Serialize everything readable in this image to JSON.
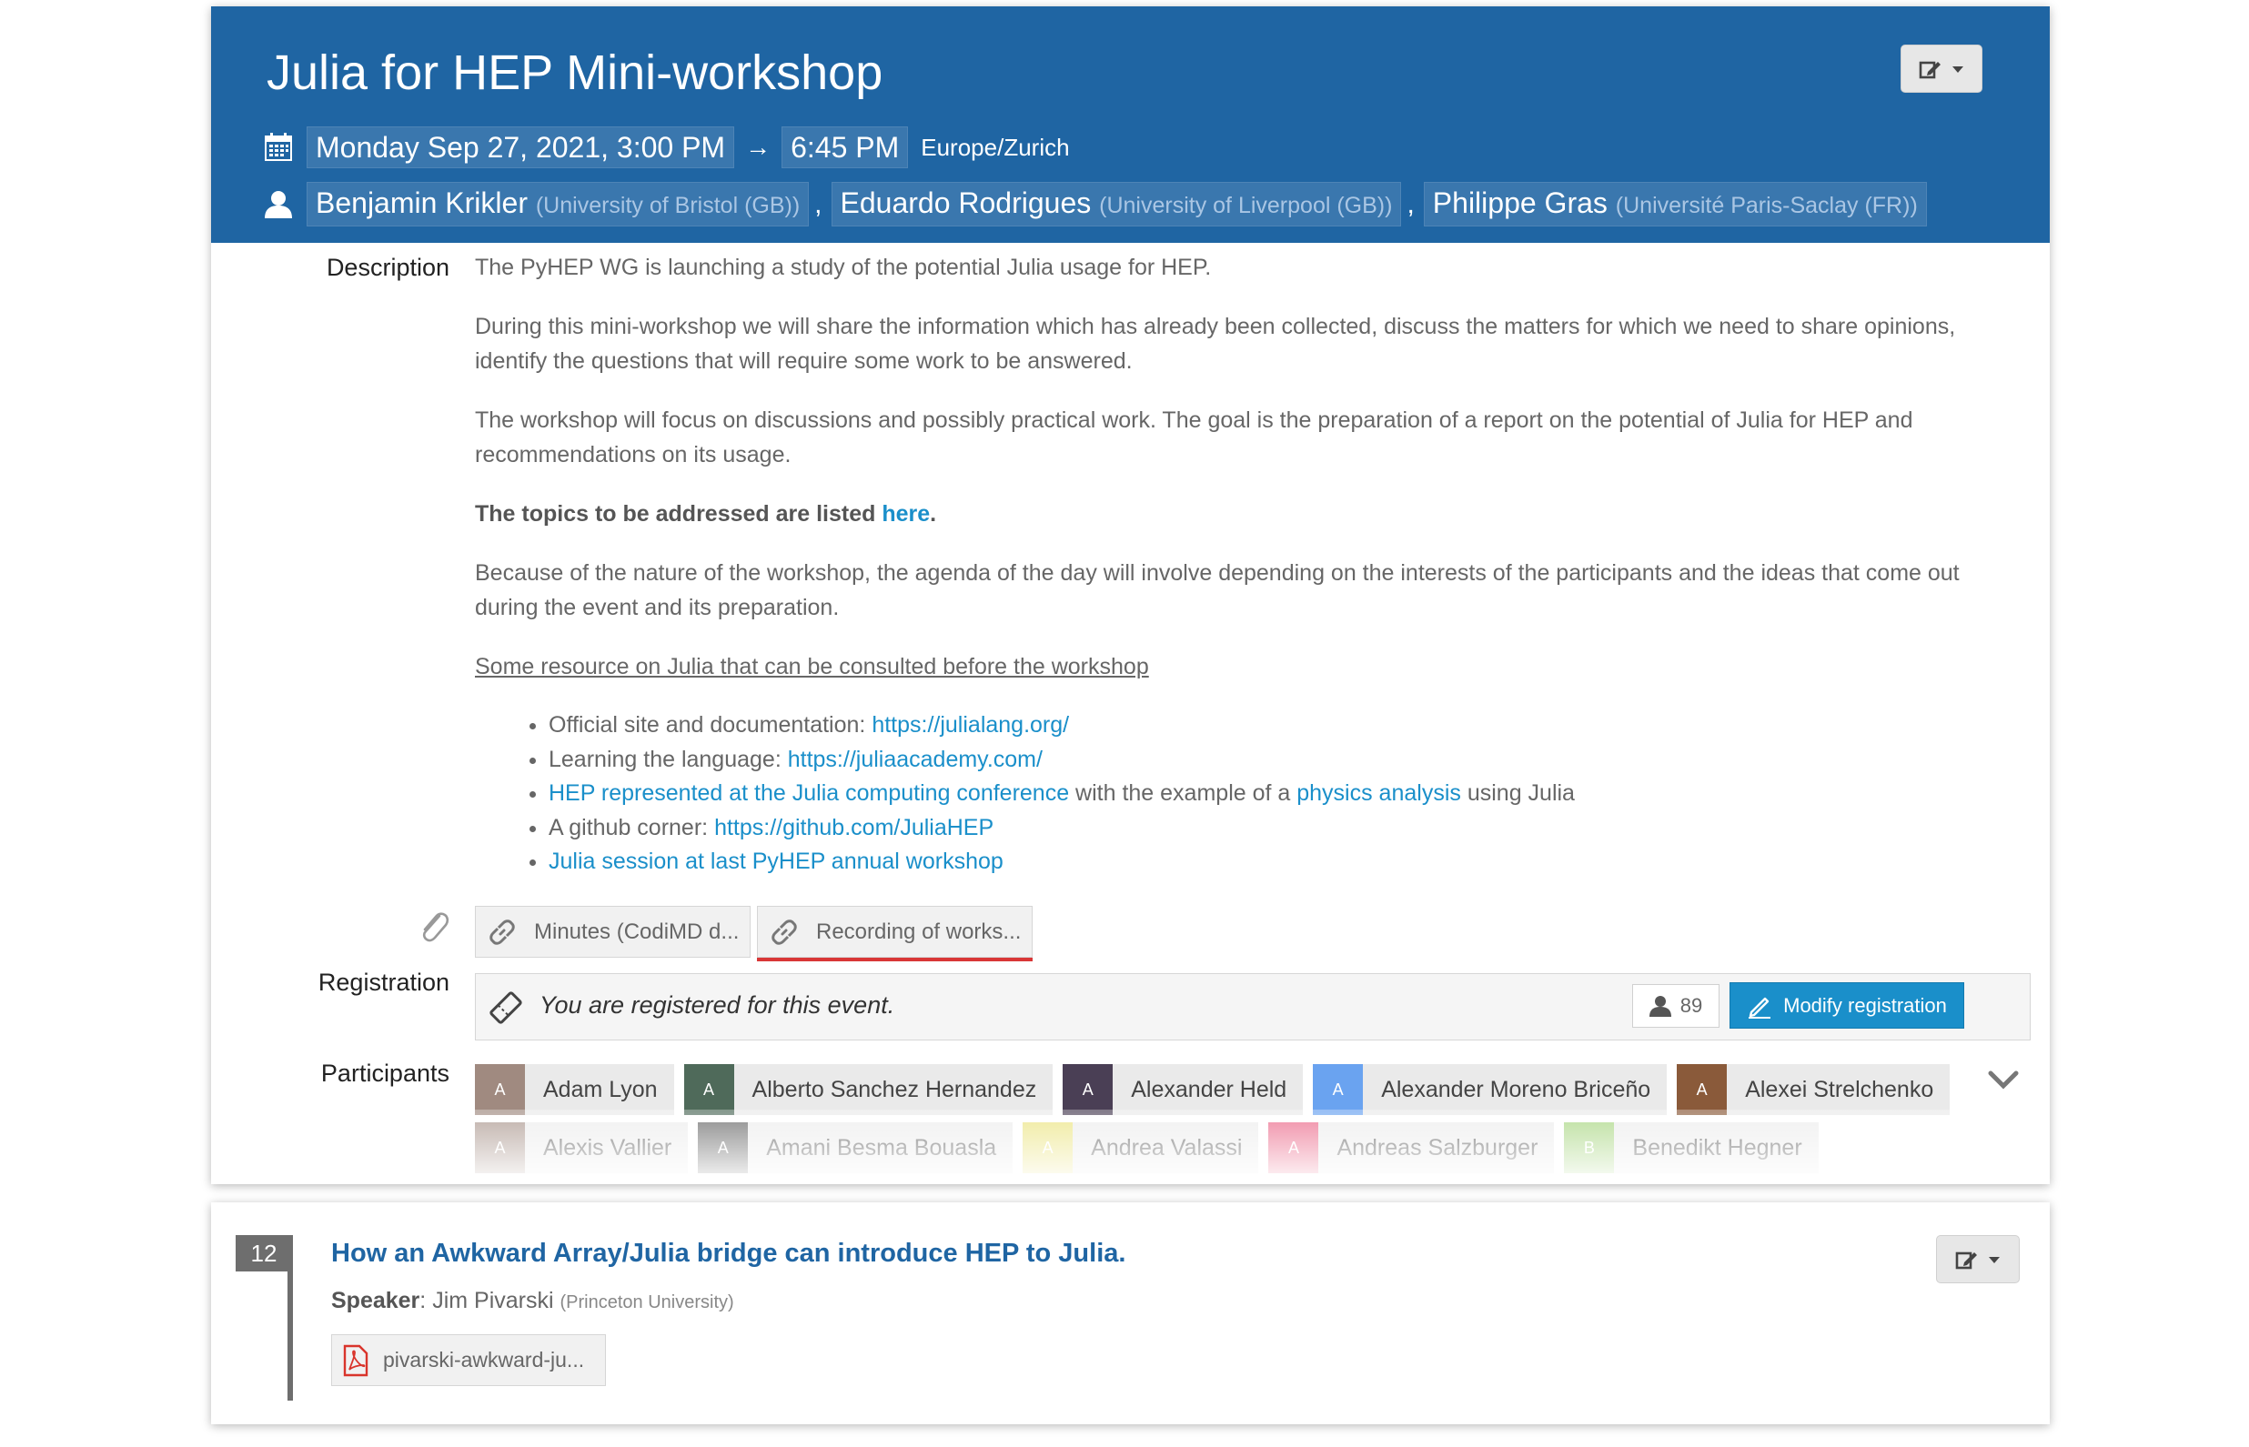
{
  "event": {
    "title": "Julia for HEP Mini-workshop",
    "start": "Monday Sep 27, 2021, 3:00 PM",
    "arrow": "→",
    "end": "6:45 PM",
    "timezone": "Europe/Zurich",
    "chairs": [
      {
        "name": "Benjamin Krikler",
        "affiliation": "(University of Bristol (GB))"
      },
      {
        "name": "Eduardo Rodrigues",
        "affiliation": "(University of Liverpool (GB))"
      },
      {
        "name": "Philippe Gras",
        "affiliation": "(Université Paris-Saclay (FR))"
      }
    ],
    "comma": ","
  },
  "labels": {
    "description": "Description",
    "registration": "Registration",
    "participants": "Participants"
  },
  "description": {
    "p1": "The PyHEP WG is launching a study of the potential Julia usage for HEP.",
    "p2": "During this mini-workshop we will share the information which has already been collected, discuss the matters for which we need to share opinions, identify the questions that will require some work to be answered.",
    "p3": "The workshop will focus on discussions and possibly practical work. The goal is the preparation of a report on the potential of Julia for HEP and recommendations on its usage.",
    "topics_text": "The topics to be addressed are listed ",
    "topics_link": "here",
    "topics_end": ".",
    "p5": "Because of the nature of the workshop, the agenda of the day will involve depending on the interests of the participants and the ideas that come out during the event and its preparation.",
    "resources_heading": "Some resource on Julia that can be consulted before the workshop",
    "resources": {
      "r1_text": "Official site and documentation: ",
      "r1_link": "https://julialang.org/",
      "r2_text": "Learning the language: ",
      "r2_link": "https://juliaacademy.com/",
      "r3_link": "HEP represented at the Julia computing conference",
      "r3_mid": " with the example of a ",
      "r3_link2": "physics analysis",
      "r3_end": " using Julia",
      "r4_text": "A github corner: ",
      "r4_link": "https://github.com/JuliaHEP",
      "r5_link": "Julia session at last PyHEP annual workshop"
    }
  },
  "attachments": [
    {
      "label": "Minutes (CodiMD d..."
    },
    {
      "label": "Recording of works..."
    }
  ],
  "registration": {
    "status": "You are registered for this event.",
    "count": "89",
    "modify_label": "Modify registration"
  },
  "participants": [
    {
      "initial": "A",
      "name": "Adam Lyon",
      "color": "#a08a80"
    },
    {
      "initial": "A",
      "name": "Alberto Sanchez Hernandez",
      "color": "#4f6a5a"
    },
    {
      "initial": "A",
      "name": "Alexander Held",
      "color": "#4a3f55"
    },
    {
      "initial": "A",
      "name": "Alexander Moreno Briceño",
      "color": "#6aa3f0"
    },
    {
      "initial": "A",
      "name": "Alexei Strelchenko",
      "color": "#8a5a3a"
    },
    {
      "initial": "A",
      "name": "Alexis Vallier",
      "color": "#a08a80"
    },
    {
      "initial": "A",
      "name": "Amani Besma Bouasla",
      "color": "#555555"
    },
    {
      "initial": "A",
      "name": "Andrea Valassi",
      "color": "#e8e070"
    },
    {
      "initial": "A",
      "name": "Andreas Salzburger",
      "color": "#e8557a"
    },
    {
      "initial": "B",
      "name": "Benedikt Hegner",
      "color": "#9cd070"
    }
  ],
  "contribution": {
    "number": "12",
    "title": "How an Awkward Array/Julia bridge can introduce HEP to Julia.",
    "speaker_label": "Speaker",
    "speaker_sep": ": ",
    "speaker_name": "Jim Pivarski",
    "speaker_affiliation": "(Princeton University)",
    "file_label": "pivarski-awkward-ju..."
  },
  "icons": {
    "calendar": "calendar-icon",
    "person": "person-icon",
    "edit": "edit-icon",
    "caret": "caret-down-icon",
    "paperclip": "paperclip-icon",
    "link": "link-icon",
    "ticket": "ticket-icon",
    "pencil": "pencil-icon",
    "chevron": "chevron-down-icon",
    "pdf": "pdf-icon"
  }
}
